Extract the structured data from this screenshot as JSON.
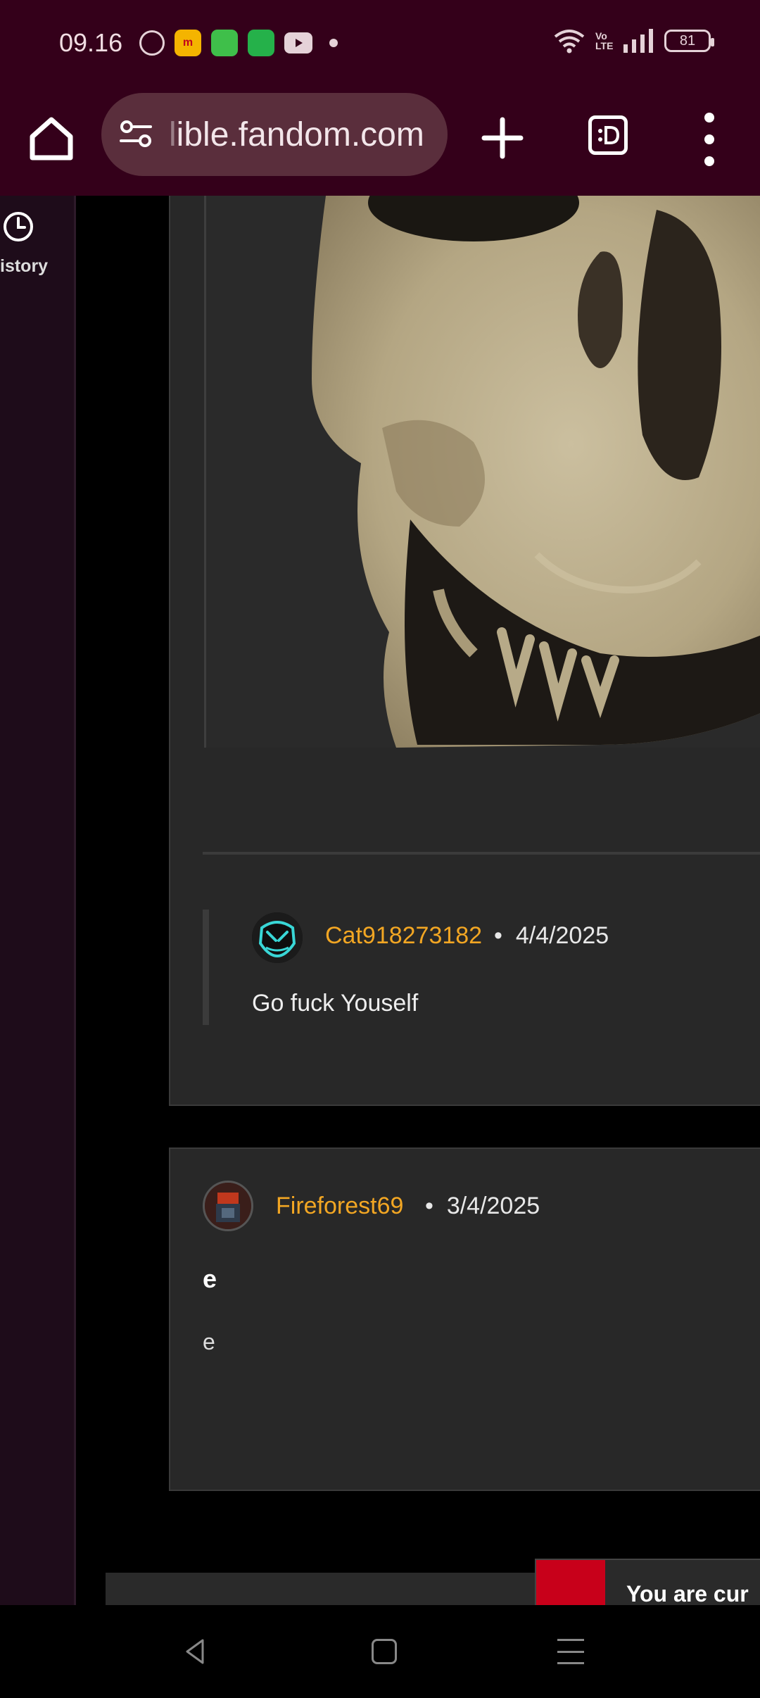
{
  "status_bar": {
    "time": "09.16",
    "notification_icons": [
      "whatsapp-icon",
      "myim3-icon",
      "shop-icon",
      "messages-icon",
      "youtube-icon"
    ],
    "network_label": "Vo LTE",
    "battery": "81"
  },
  "toolbar": {
    "url_prefix": "l",
    "url_main": "ible.fandom.com"
  },
  "sidebar": {
    "history_label": "istory"
  },
  "reply": {
    "username": "Cat918273182",
    "separator": "•",
    "date": "4/4/2025",
    "text": "Go fuck Youself"
  },
  "comment": {
    "username": "Fireforest69",
    "separator": "•",
    "date": "3/4/2025",
    "title": "e",
    "body": "e"
  },
  "toast": {
    "text": "You are cur"
  },
  "colors": {
    "username": "#f2a623",
    "browser_chrome": "#34001a",
    "card": "#282828"
  }
}
